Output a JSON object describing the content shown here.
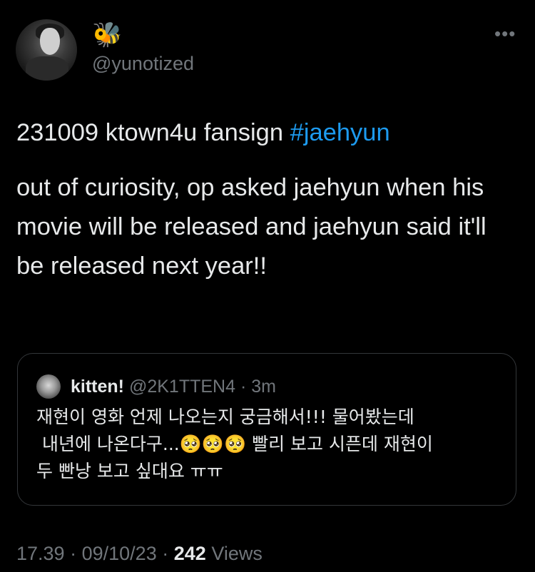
{
  "author": {
    "display_emoji": "🐝",
    "handle": "@yunotized"
  },
  "more_icon": "more-horizontal-icon",
  "tweet": {
    "line1_text": "231009 ktown4u fansign ",
    "hashtag": "#jaehyun",
    "body": "out of curiosity, op asked jaehyun when his movie will be released and jaehyun said it'll be released next year!!"
  },
  "quoted": {
    "name": "kitten!",
    "handle": "@2K1TTEN4",
    "separator": "·",
    "time": "3m",
    "text_line1": "재현이 영화 언제 나오는지 궁금해서!!! 물어봤는데",
    "text_line2": " 내년에 나온다구...🥺🥺🥺 빨리 보고 시픈데 재현이",
    "text_line3": "두 빤낭 보고 싶대요 ㅠㅠ"
  },
  "meta": {
    "time": "17.39",
    "sep1": "·",
    "date": "09/10/23",
    "sep2": "·",
    "views_count": "242",
    "views_label": "Views"
  },
  "colors": {
    "background": "#000000",
    "text": "#e7e9ea",
    "secondary": "#71767b",
    "link": "#1d9bf0",
    "border": "#333639"
  }
}
